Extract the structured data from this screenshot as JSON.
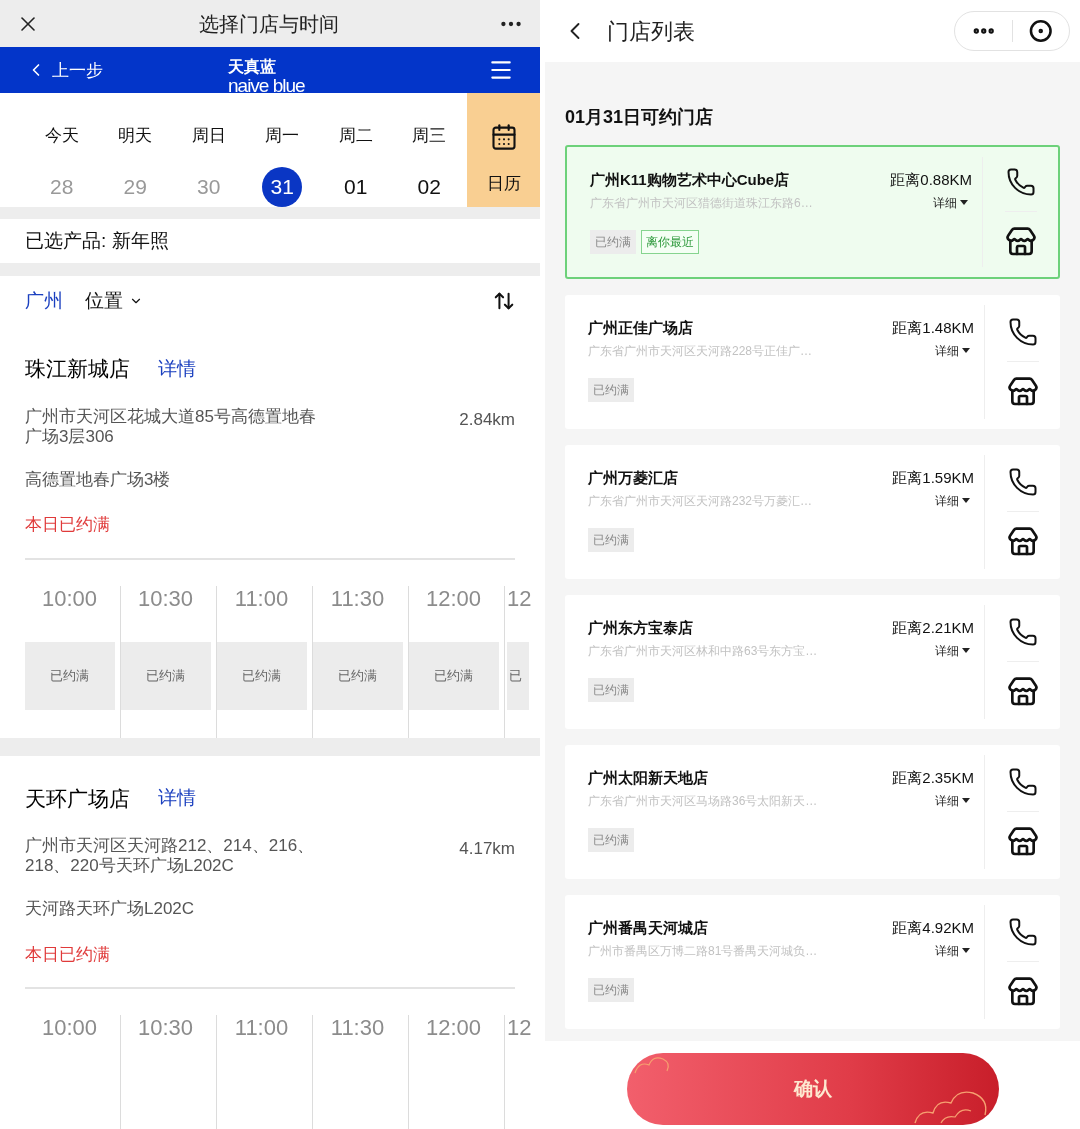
{
  "left": {
    "top_bar": {
      "title": "选择门店与时间"
    },
    "header": {
      "back": "上一步",
      "logo_cn": "天真蓝",
      "logo_en": "naive blue"
    },
    "days": [
      {
        "label": "今天",
        "date": "28",
        "disabled": true,
        "selected": false
      },
      {
        "label": "明天",
        "date": "29",
        "disabled": true,
        "selected": false
      },
      {
        "label": "周日",
        "date": "30",
        "disabled": true,
        "selected": false
      },
      {
        "label": "周一",
        "date": "31",
        "disabled": false,
        "selected": true
      },
      {
        "label": "周二",
        "date": "01",
        "disabled": false,
        "selected": false
      },
      {
        "label": "周三",
        "date": "02",
        "disabled": false,
        "selected": false
      }
    ],
    "calendar_button": "日历",
    "selected_product": "已选产品: 新年照",
    "filter": {
      "city": "广州",
      "location": "位置"
    },
    "stores": [
      {
        "name": "珠江新城店",
        "details_link": "详情",
        "address": "广州市天河区花城大道85号高德置地春广场3层306",
        "distance": "2.84km",
        "floor": "高德置地春广场3楼",
        "status": "本日已约满",
        "slots": [
          {
            "time": "10:00",
            "status": "已约满"
          },
          {
            "time": "10:30",
            "status": "已约满"
          },
          {
            "time": "11:00",
            "status": "已约满"
          },
          {
            "time": "11:30",
            "status": "已约满"
          },
          {
            "time": "12:00",
            "status": "已约满"
          },
          {
            "time": "12",
            "status": "已"
          }
        ]
      },
      {
        "name": "天环广场店",
        "details_link": "详情",
        "address": "广州市天河区天河路212、214、216、218、220号天环广场L202C",
        "distance": "4.17km",
        "floor": "天河路天环广场L202C",
        "status": "本日已约满",
        "slots": [
          {
            "time": "10:00"
          },
          {
            "time": "10:30"
          },
          {
            "time": "11:00"
          },
          {
            "time": "11:30"
          },
          {
            "time": "12:00"
          },
          {
            "time": "12"
          }
        ]
      }
    ]
  },
  "right": {
    "title": "门店列表",
    "heading": "01月31日可约门店",
    "stores": [
      {
        "name": "广州K11购物艺术中心Cube店",
        "distance": "距离0.88KM",
        "address": "广东省广州市天河区猎德街道珠江东路6…",
        "details": "详细",
        "selected": true,
        "tags": [
          {
            "text": "已约满",
            "kind": "status"
          },
          {
            "text": "离你最近",
            "kind": "nearest"
          }
        ]
      },
      {
        "name": "广州正佳广场店",
        "distance": "距离1.48KM",
        "address": "广东省广州市天河区天河路228号正佳广…",
        "details": "详细",
        "selected": false,
        "tags": [
          {
            "text": "已约满",
            "kind": "status"
          }
        ]
      },
      {
        "name": "广州万菱汇店",
        "distance": "距离1.59KM",
        "address": "广东省广州市天河区天河路232号万菱汇…",
        "details": "详细",
        "selected": false,
        "tags": [
          {
            "text": "已约满",
            "kind": "status"
          }
        ]
      },
      {
        "name": "广州东方宝泰店",
        "distance": "距离2.21KM",
        "address": "广东省广州市天河区林和中路63号东方宝…",
        "details": "详细",
        "selected": false,
        "tags": [
          {
            "text": "已约满",
            "kind": "status"
          }
        ]
      },
      {
        "name": "广州太阳新天地店",
        "distance": "距离2.35KM",
        "address": "广东省广州市天河区马场路36号太阳新天…",
        "details": "详细",
        "selected": false,
        "tags": [
          {
            "text": "已约满",
            "kind": "status"
          }
        ]
      },
      {
        "name": "广州番禺天河城店",
        "distance": "距离4.92KM",
        "address": "广州市番禺区万博二路81号番禺天河城负…",
        "details": "详细",
        "selected": false,
        "tags": [
          {
            "text": "已约满",
            "kind": "status"
          }
        ]
      }
    ],
    "confirm": "确认"
  }
}
